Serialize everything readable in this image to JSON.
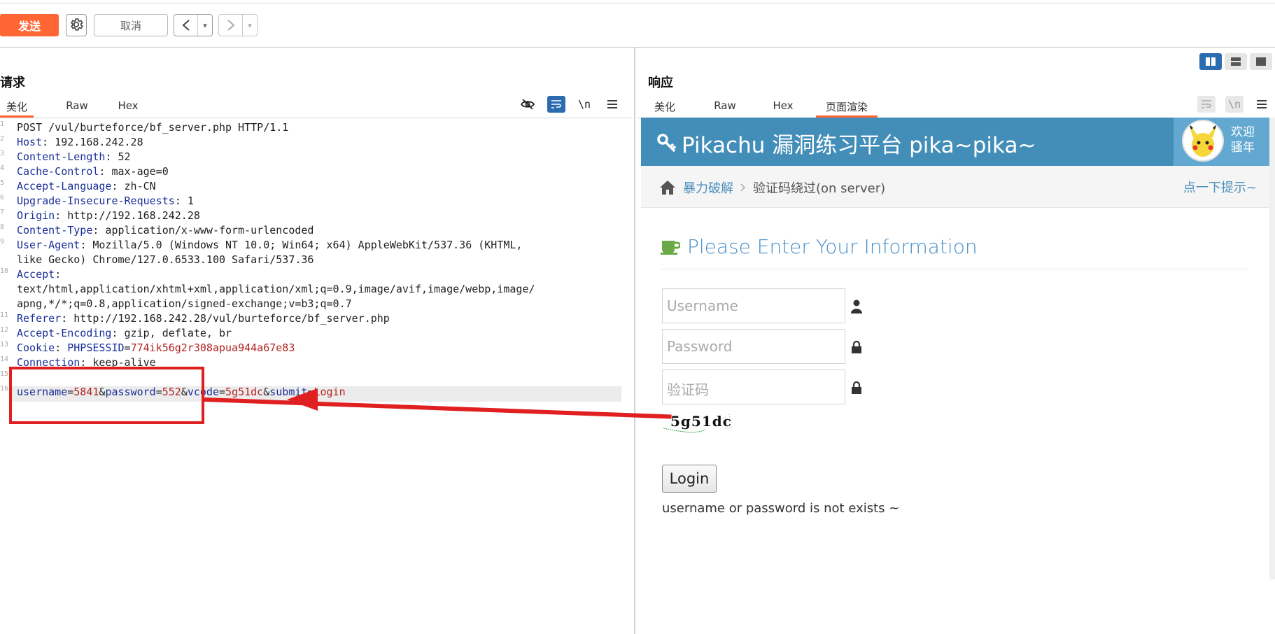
{
  "toolbar": {
    "send_label": "发送",
    "cancel_label": "取消",
    "back_label": "<",
    "forward_label": ">",
    "dropdown_glyph": "▾"
  },
  "request": {
    "title": "请求",
    "tabs": [
      "美化",
      "Raw",
      "Hex"
    ],
    "active_tab": "美化",
    "tools": {
      "wrap_icon": "wrap-lines-icon",
      "newline_label": "\\n",
      "menu_icon": "menu-icon"
    },
    "lines": [
      {
        "key": "",
        "value": "POST /vul/burteforce/bf_server.php HTTP/1.1",
        "plain": true
      },
      {
        "key": "Host",
        "value": "192.168.242.28"
      },
      {
        "key": "Content-Length",
        "value": "52"
      },
      {
        "key": "Cache-Control",
        "value": "max-age=0"
      },
      {
        "key": "Accept-Language",
        "value": "zh-CN"
      },
      {
        "key": "Upgrade-Insecure-Requests",
        "value": "1"
      },
      {
        "key": "Origin",
        "value": "http://192.168.242.28"
      },
      {
        "key": "Content-Type",
        "value": "application/x-www-form-urlencoded"
      },
      {
        "key": "User-Agent",
        "value": "Mozilla/5.0 (Windows NT 10.0; Win64; x64) AppleWebKit/537.36 (KHTML,"
      },
      {
        "key": "",
        "value": "like Gecko) Chrome/127.0.6533.100 Safari/537.36",
        "plain": true
      },
      {
        "key": "Accept",
        "value": ""
      },
      {
        "key": "",
        "value": "text/html,application/xhtml+xml,application/xml;q=0.9,image/avif,image/webp,image/",
        "plain": true
      },
      {
        "key": "",
        "value": "apng,*/*;q=0.8,application/signed-exchange;v=b3;q=0.7",
        "plain": true
      },
      {
        "key": "Referer",
        "value": "http://192.168.242.28/vul/burteforce/bf_server.php"
      },
      {
        "key": "Accept-Encoding",
        "value": "gzip, deflate, br"
      },
      {
        "key": "Cookie",
        "value": "PHPSESSID=774ik56g2r308apua944a67e83",
        "cookie": true
      },
      {
        "key": "Connection",
        "value": "keep-alive"
      },
      {
        "key": "",
        "value": "",
        "plain": true
      }
    ],
    "body_line": [
      {
        "k": "username",
        "v": "5841"
      },
      {
        "k": "password",
        "v": "552"
      },
      {
        "k": "vcode",
        "v": "5g51dc"
      },
      {
        "k": "submit",
        "v": "Login"
      }
    ],
    "gutter": [
      "1",
      "2",
      "3",
      "4",
      "5",
      "6",
      "7",
      "8",
      "9",
      "",
      "10",
      "",
      "",
      "11",
      "12",
      "13",
      "14",
      "15",
      "16"
    ]
  },
  "response": {
    "title": "响应",
    "tabs": [
      "美化",
      "Raw",
      "Hex",
      "页面渲染"
    ],
    "active_tab": "页面渲染",
    "tools": {
      "newline_label": "\\n"
    }
  },
  "page": {
    "brand": "Pikachu 漏洞练习平台 pika~pika~",
    "welcome": [
      "欢迎",
      "骚年"
    ],
    "breadcrumb": {
      "parent": "暴力破解",
      "current": "验证码绕过(on server)"
    },
    "hint": "点一下提示~",
    "form_title": "Please Enter Your Information",
    "username_placeholder": "Username",
    "password_placeholder": "Password",
    "vcode_placeholder": "验证码",
    "captcha_text": "5g51dc",
    "login_label": "Login",
    "message": "username or password is not exists ~"
  },
  "colors": {
    "send": "#ff6633",
    "brand_bar": "#438eb9",
    "highlight": "#e02020",
    "link": "#4c8fbd"
  }
}
